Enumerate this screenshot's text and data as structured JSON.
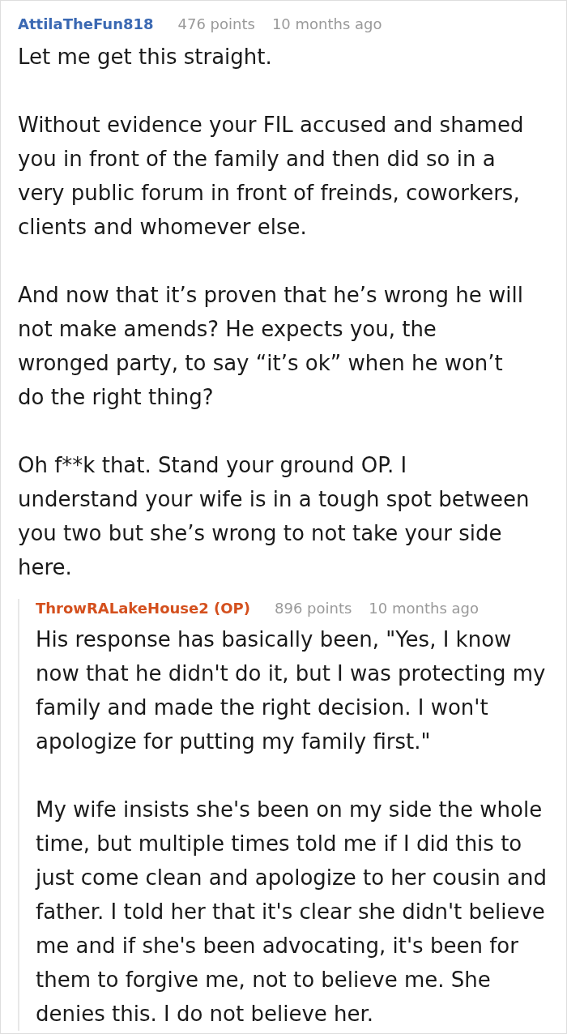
{
  "comments": [
    {
      "author": "AttilaTheFun818",
      "op": false,
      "points": "476 points",
      "time": "10 months ago",
      "paragraphs": [
        "Let me get this straight.",
        "Without evidence your FIL accused and shamed you in front of the family and then did so in a very public forum in front of freinds, coworkers, clients and whomever else.",
        "And now that it’s proven that he’s wrong he will not make amends? He expects you, the wronged party, to say “it’s ok” when he won’t do the right thing?",
        "Oh f**k that. Stand your ground OP. I understand your wife is in a tough spot between you two but she’s wrong to not take your side here."
      ],
      "replies": [
        {
          "author": "ThrowRALakeHouse2 (OP)",
          "op": true,
          "points": "896 points",
          "time": "10 months ago",
          "paragraphs": [
            "His response has basically been, \"Yes, I know now that he didn't do it, but I was protecting my family and made the right decision. I won't apologize for putting my family first.\"",
            "My wife insists she's been on my side the whole time, but multiple times told me if I did this to just come clean and apologize to her cousin and father. I told her that it's clear she didn't believe me and if she's been advocating, it's been for them to forgive me, not to believe me. She denies this. I do not believe her."
          ]
        }
      ]
    }
  ]
}
